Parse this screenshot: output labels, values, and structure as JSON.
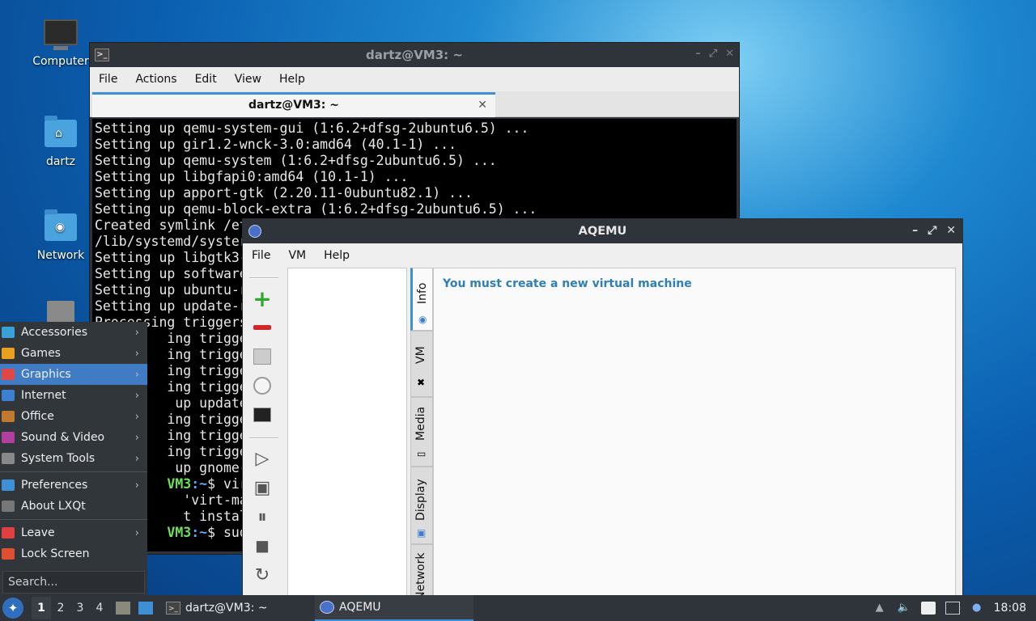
{
  "desktop": {
    "icons": [
      {
        "label": "Computer"
      },
      {
        "label": "dartz"
      },
      {
        "label": "Network"
      },
      {
        "label": ""
      }
    ]
  },
  "terminal": {
    "title": "dartz@VM3: ~",
    "menu": [
      "File",
      "Actions",
      "Edit",
      "View",
      "Help"
    ],
    "tab_label": "dartz@VM3: ~",
    "lines": [
      "Setting up qemu-system-gui (1:6.2+dfsg-2ubuntu6.5) ...",
      "Setting up gir1.2-wnck-3.0:amd64 (40.1-1) ...",
      "Setting up qemu-system (1:6.2+dfsg-2ubuntu6.5) ...",
      "Setting up libgfapi0:amd64 (10.1-1) ...",
      "Setting up apport-gtk (2.20.11-0ubuntu82.1) ...",
      "Setting up qemu-block-extra (1:6.2+dfsg-2ubuntu6.5) ...",
      "Created symlink /et",
      "/lib/systemd/syster",
      "Setting up libgtk3-",
      "Setting up software",
      "Setting up ubuntu-r",
      "Setting up update-r",
      "Processing triggers",
      "         ing triggers",
      "         ing triggers",
      "         ing triggers",
      "         ing triggers",
      "          up update-r",
      "         ing triggers",
      "         ing triggers",
      "         ing triggers",
      "          up gnome-s"
    ],
    "prompt_lines": [
      {
        "user": "VM3",
        "path": ":~",
        "cmd": "$ virt-m"
      },
      {
        "user": "",
        "path": "",
        "cmd": "'virt-manag"
      },
      {
        "user": "",
        "path": "",
        "cmd": "t install vi"
      },
      {
        "user": "VM3",
        "path": ":~",
        "cmd": "$ sudo a"
      }
    ]
  },
  "aqemu": {
    "title": "AQEMU",
    "menu": [
      "File",
      "VM",
      "Help"
    ],
    "tabs": [
      "Info",
      "VM",
      "Media",
      "Display",
      "Network"
    ],
    "info_message": "You must create a new virtual machine"
  },
  "start_menu": {
    "categories": [
      {
        "label": "Accessories",
        "color": "#3aa0d8"
      },
      {
        "label": "Games",
        "color": "#e8a020"
      },
      {
        "label": "Graphics",
        "color": "#e04848"
      },
      {
        "label": "Internet",
        "color": "#3d7fd0"
      },
      {
        "label": "Office",
        "color": "#c07a30"
      },
      {
        "label": "Sound & Video",
        "color": "#b040a0"
      },
      {
        "label": "System Tools",
        "color": "#888888"
      }
    ],
    "settings": [
      {
        "label": "Preferences",
        "color": "#3d8fd6",
        "arrow": true
      },
      {
        "label": "About LXQt",
        "color": "#777777",
        "arrow": false
      }
    ],
    "session": [
      {
        "label": "Leave",
        "color": "#e04040",
        "arrow": true
      },
      {
        "label": "Lock Screen",
        "color": "#e05030",
        "arrow": false
      }
    ],
    "search_placeholder": "Search..."
  },
  "taskbar": {
    "desktops": [
      "1",
      "2",
      "3",
      "4"
    ],
    "tasks": [
      {
        "label": "dartz@VM3: ~"
      },
      {
        "label": "AQEMU"
      }
    ],
    "clock": "18:08"
  }
}
